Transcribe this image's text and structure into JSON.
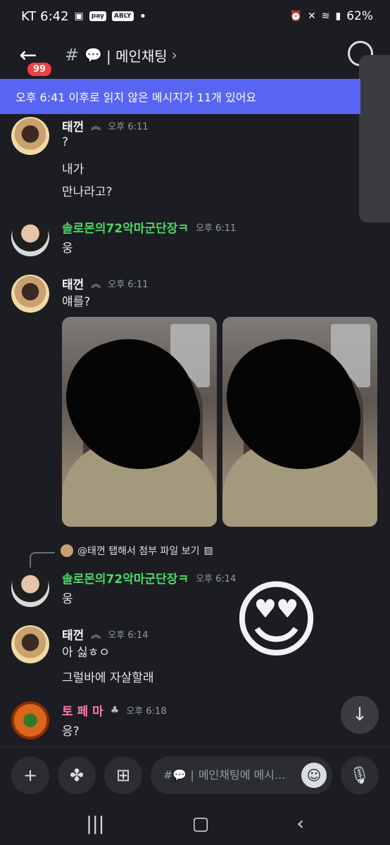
{
  "status_bar": {
    "carrier_time": "KT 6:42",
    "chip_pay": "pay",
    "chip_ably": "ABLY",
    "dot": "•",
    "battery": "62%"
  },
  "header": {
    "badge_count": "99",
    "hash": "#",
    "channel_icon": "💬",
    "channel_name": "| 메인채팅",
    "chevron": "›"
  },
  "unread_banner": "오후 6:41 이후로 읽지 않은 메시지가 11개 있어요",
  "messages": [
    {
      "author": "태껀",
      "time": "오후 6:11",
      "lines": [
        "?",
        "내가",
        "만나라고?"
      ]
    },
    {
      "author": "솔로몬의72악마군단장ㅋ",
      "time": "오후 6:11",
      "lines": [
        "웅"
      ]
    },
    {
      "author": "태껀",
      "time": "오후 6:11",
      "lines": [
        "얘를?"
      ]
    },
    {
      "author": "솔로몬의72악마군단장ㅋ",
      "time": "오후 6:14",
      "reply_text": "@태껀  탭해서 첨부 파일 보기",
      "lines": [
        "웅"
      ]
    },
    {
      "author": "태껀",
      "time": "오후 6:14",
      "lines": [
        "아 싫ㅎㅇ",
        "그럴바에 자살할래"
      ]
    },
    {
      "author": "토 페 마",
      "time": "오후 6:18",
      "lines": [
        "응?"
      ]
    }
  ],
  "sticker_emoji": "😍",
  "composer": {
    "placeholder": "메인채팅에 메시...",
    "prefix": "#💬 |"
  },
  "icons": {
    "back": "back-arrow-icon",
    "search": "search-icon",
    "add": "plus-icon",
    "apps": "apps-icon",
    "gift": "gift-icon",
    "emoji": "emoji-icon",
    "mic": "mic-icon",
    "jump": "arrow-down-icon"
  },
  "colors": {
    "background": "#1c1d22",
    "banner": "#5865f2",
    "badge": "#f23f43",
    "green_name": "#4cd964",
    "pink_name": "#ff7aa8"
  }
}
